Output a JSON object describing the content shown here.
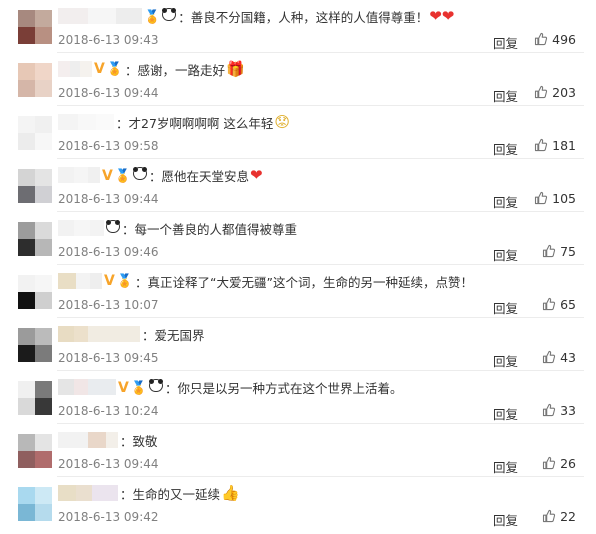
{
  "reply_label": "回复",
  "comments": [
    {
      "text": "：善良不分国籍，人种，这样的人值得尊重！",
      "emoji": "❤❤",
      "emoji_class": "emo-heart",
      "time": "2018-6-13 09:43",
      "likes": "496",
      "avatar_colors": [
        "#a7897f",
        "#c3aa9d",
        "#7a3e37",
        "#b89082"
      ],
      "nick_colors": [
        "#f2eeee",
        "#f6f6f6",
        "#ededed"
      ],
      "badges": [
        "icon",
        "panda"
      ]
    },
    {
      "text": "：感谢，一路走好",
      "emoji": "🎁",
      "emoji_class": "emo-gift",
      "time": "2018-6-13 09:44",
      "likes": "203",
      "avatar_colors": [
        "#e7c8b6",
        "#f0d6c8",
        "#d5b6a8",
        "#e8d2c6"
      ],
      "nick_colors": [
        "#f4eeee",
        "#eeeeee",
        "#f5f2ee"
      ],
      "badges": [
        "v",
        "icon"
      ]
    },
    {
      "text": "：才27岁啊啊啊啊 这么年轻",
      "emoji": "😟",
      "emoji_class": "emo-face",
      "time": "2018-6-13 09:58",
      "likes": "181",
      "avatar_colors": [
        "#f4f4f4",
        "#f0f0f0",
        "#ececec",
        "#f7f7f7"
      ],
      "nick_colors": [
        "#f4f4f4",
        "#f8f8f8",
        "#fafafa"
      ],
      "badges": []
    },
    {
      "text": "：愿他在天堂安息",
      "emoji": "❤",
      "emoji_class": "emo-heart",
      "time": "2018-6-13 09:44",
      "likes": "105",
      "avatar_colors": [
        "#d4d4d4",
        "#e4e4e4",
        "#6d6d72",
        "#d0d0d4"
      ],
      "nick_colors": [
        "#f2f2f2",
        "#f5f5f5",
        "#f0f0f0"
      ],
      "badges": [
        "v",
        "icon",
        "panda"
      ]
    },
    {
      "text": "：每一个善良的人都值得被尊重",
      "emoji": "",
      "emoji_class": "",
      "time": "2018-6-13 09:46",
      "likes": "75",
      "avatar_colors": [
        "#9c9c9c",
        "#dadada",
        "#2d2d2d",
        "#b7b7b7"
      ],
      "nick_colors": [
        "#f2f2f2",
        "#f6f6f6",
        "#f3f3f3"
      ],
      "badges": [
        "panda"
      ]
    },
    {
      "text": "：真正诠释了“大爱无疆”这个词，生命的另一种延续，点赞！",
      "emoji": "",
      "emoji_class": "",
      "time": "2018-6-13 10:07",
      "likes": "65",
      "avatar_colors": [
        "#f2f2f2",
        "#f6f6f6",
        "#111111",
        "#cfcfcf"
      ],
      "nick_colors": [
        "#e9dec5",
        "#f3f3f3",
        "#eeeeee"
      ],
      "badges": [
        "v",
        "icon"
      ]
    },
    {
      "text": "：爱无国界",
      "emoji": "",
      "emoji_class": "",
      "time": "2018-6-13 09:45",
      "likes": "43",
      "avatar_colors": [
        "#9b9b9b",
        "#bbbbbb",
        "#1b1b1b",
        "#7b7b7b"
      ],
      "nick_colors": [
        "#e8dcc3",
        "#ece0cb",
        "#f1ece2"
      ],
      "badges": []
    },
    {
      "text": "：你只是以另一种方式在这个世界上活着。",
      "emoji": "",
      "emoji_class": "",
      "time": "2018-6-13 10:24",
      "likes": "33",
      "avatar_colors": [
        "#f0f0f0",
        "#7a7a7a",
        "#d9d9d9",
        "#383838"
      ],
      "nick_colors": [
        "#e5e5e5",
        "#f1e6e6",
        "#e9ecef"
      ],
      "badges": [
        "v",
        "icon",
        "panda"
      ]
    },
    {
      "text": "：致敬",
      "emoji": "",
      "emoji_class": "",
      "time": "2018-6-13 09:44",
      "likes": "26",
      "avatar_colors": [
        "#b8b8b8",
        "#e4e4e4",
        "#8f5f5f",
        "#b06c6c"
      ],
      "nick_colors": [
        "#f2f2f2",
        "#e9d7c9",
        "#f3efe9"
      ],
      "badges": []
    },
    {
      "text": "：生命的又一延续",
      "emoji": "👍",
      "emoji_class": "emo-thumb",
      "time": "2018-6-13 09:42",
      "likes": "22",
      "avatar_colors": [
        "#a9d9ef",
        "#cde9f5",
        "#7ab7d5",
        "#b5dbed"
      ],
      "nick_colors": [
        "#e8dec6",
        "#eadfcf",
        "#ebe4ee"
      ],
      "badges": []
    }
  ]
}
